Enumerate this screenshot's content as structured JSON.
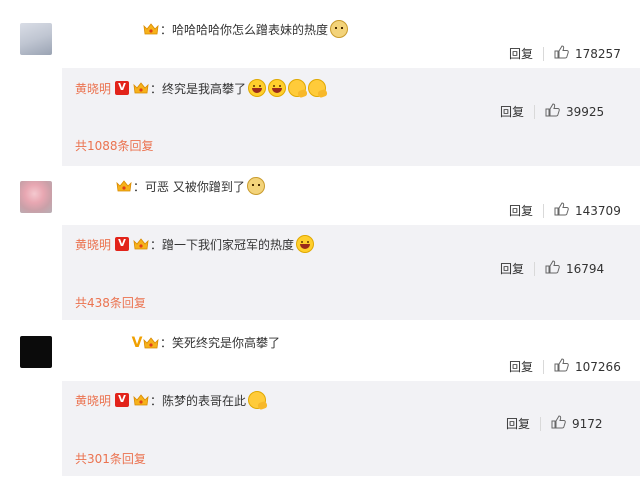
{
  "comments": [
    {
      "text": "：哈哈哈哈你怎么蹭表妹的热度",
      "reply_label": "回复",
      "likes": "178257",
      "reply": {
        "name": "黄晓明",
        "text": "：终究是我高攀了",
        "reply_label": "回复",
        "likes": "39925"
      },
      "more": "共1088条回复"
    },
    {
      "text": "：可恶 又被你蹭到了",
      "reply_label": "回复",
      "likes": "143709",
      "reply": {
        "name": "黄晓明",
        "text": "：蹭一下我们家冠军的热度",
        "reply_label": "回复",
        "likes": "16794"
      },
      "more": "共438条回复"
    },
    {
      "text": "：笑死终究是你高攀了",
      "reply_label": "回复",
      "likes": "107266",
      "reply": {
        "name": "黄晓明",
        "text": "：陈梦的表哥在此",
        "reply_label": "回复",
        "likes": "9172"
      },
      "more": "共301条回复"
    }
  ],
  "icons": {
    "vip": "vip-crown-icon",
    "verified": "verified-v-icon",
    "like": "thumbs-up-icon",
    "emoji_laugh": "laughing-emoji-icon",
    "emoji_doge": "doge-emoji-icon",
    "emoji_think": "thinking-emoji-icon"
  },
  "colors": {
    "name": "#eb7350",
    "reply_bg": "#f2f2f5",
    "verified_red": "#e2231a"
  }
}
